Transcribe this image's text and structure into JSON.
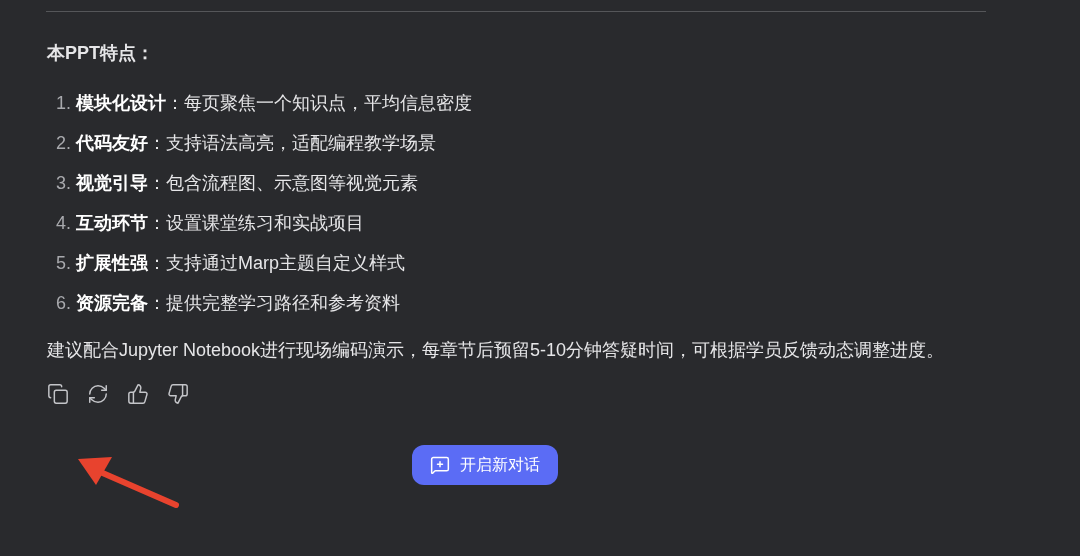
{
  "message": {
    "heading": "本PPT特点：",
    "features": [
      {
        "number": "1.",
        "term": "模块化设计",
        "text": "：每页聚焦一个知识点，平均信息密度"
      },
      {
        "number": "2.",
        "term": "代码友好",
        "text": "：支持语法高亮，适配编程教学场景"
      },
      {
        "number": "3.",
        "term": "视觉引导",
        "text": "：包含流程图、示意图等视觉元素"
      },
      {
        "number": "4.",
        "term": "互动环节",
        "text": "：设置课堂练习和实战项目"
      },
      {
        "number": "5.",
        "term": "扩展性强",
        "text": "：支持通过Marp主题自定义样式"
      },
      {
        "number": "6.",
        "term": "资源完备",
        "text": "：提供完整学习路径和参考资料"
      }
    ],
    "paragraph": "建议配合Jupyter Notebook进行现场编码演示，每章节后预留5-10分钟答疑时间，可根据学员反馈动态调整进度。"
  },
  "new_chat_button": {
    "label": "开启新对话"
  }
}
